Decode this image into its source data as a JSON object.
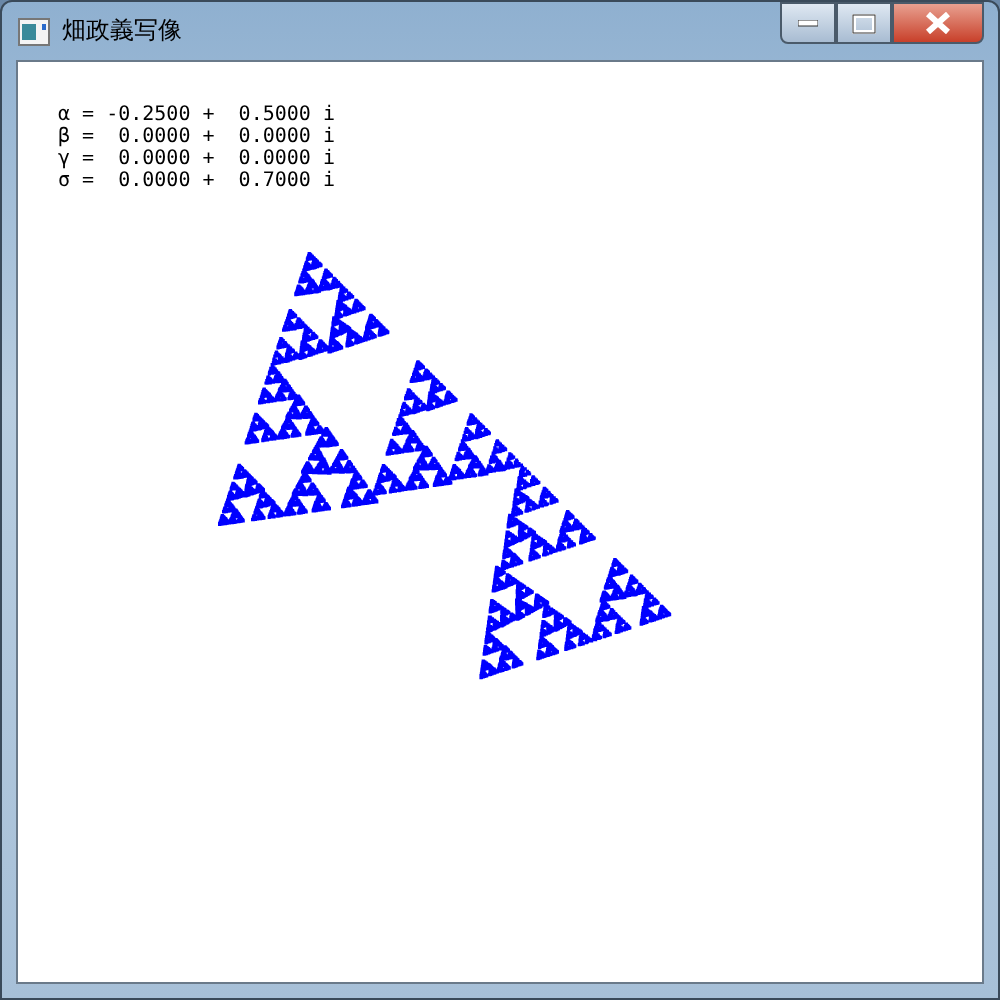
{
  "window": {
    "title": "畑政義写像"
  },
  "parameters": [
    {
      "line": "α = -0.2500 +  0.5000 i"
    },
    {
      "line": "β =  0.0000 +  0.0000 i"
    },
    {
      "line": "γ =  0.0000 +  0.0000 i"
    },
    {
      "line": "σ =  0.0000 +  0.7000 i"
    }
  ]
}
